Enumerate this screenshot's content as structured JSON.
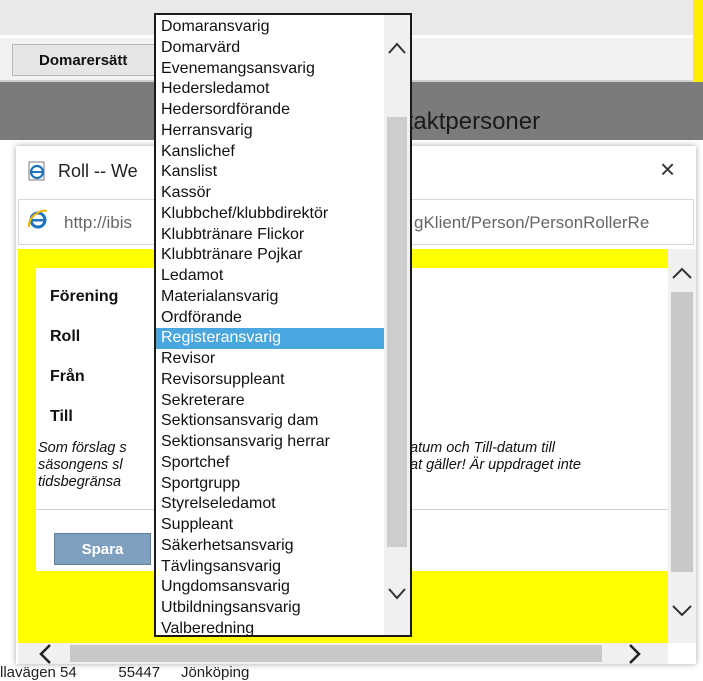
{
  "background": {
    "tab_label": "Domarersätt",
    "heading": "ontaktpersoner",
    "bottom_text": "llavägen 54          55447     Jönköping"
  },
  "popup": {
    "title": "Roll -- We",
    "url": "http://ibis",
    "url_right": "gKlient/Person/PersonRollerRe",
    "close_glyph": "×"
  },
  "form": {
    "labels": [
      "Förening",
      "Roll",
      "Från",
      "Till"
    ],
    "note_left": "Som förslag s\nsäsongens sl\ntidsbegränsa",
    "note_right": "atum och Till-datum till\nat gäller! Är uppdraget inte",
    "save_label": "Spara"
  },
  "dropdown": {
    "selected": "Registeransvarig",
    "options": [
      "Domaransvarig",
      "Domarvärd",
      "Evenemangsansvarig",
      "Hedersledamot",
      "Hedersordförande",
      "Herransvarig",
      "Kanslichef",
      "Kanslist",
      "Kassör",
      "Klubbchef/klubbdirektör",
      "Klubbtränare Flickor",
      "Klubbtränare Pojkar",
      "Ledamot",
      "Materialansvarig",
      "Ordförande",
      "Registeransvarig",
      "Revisor",
      "Revisorsuppleant",
      "Sekreterare",
      "Sektionsansvarig dam",
      "Sektionsansvarig herrar",
      "Sportchef",
      "Sportgrupp",
      "Styrelseledamot",
      "Suppleant",
      "Säkerhetsansvarig",
      "Tävlingsansvarig",
      "Ungdomsansvarig",
      "Utbildningsansvarig",
      "Valberedning"
    ]
  },
  "icons": {
    "window_icon": "ie-page-icon",
    "address_icon": "ie-logo-icon",
    "scroll_up": "chevron-up-icon",
    "scroll_down": "chevron-down-icon",
    "scroll_left": "chevron-left-icon",
    "scroll_right": "chevron-right-icon"
  },
  "colors": {
    "accent_yellow": "#ffff00",
    "selection": "#4aa6de",
    "save_button": "#7f9fbe"
  }
}
